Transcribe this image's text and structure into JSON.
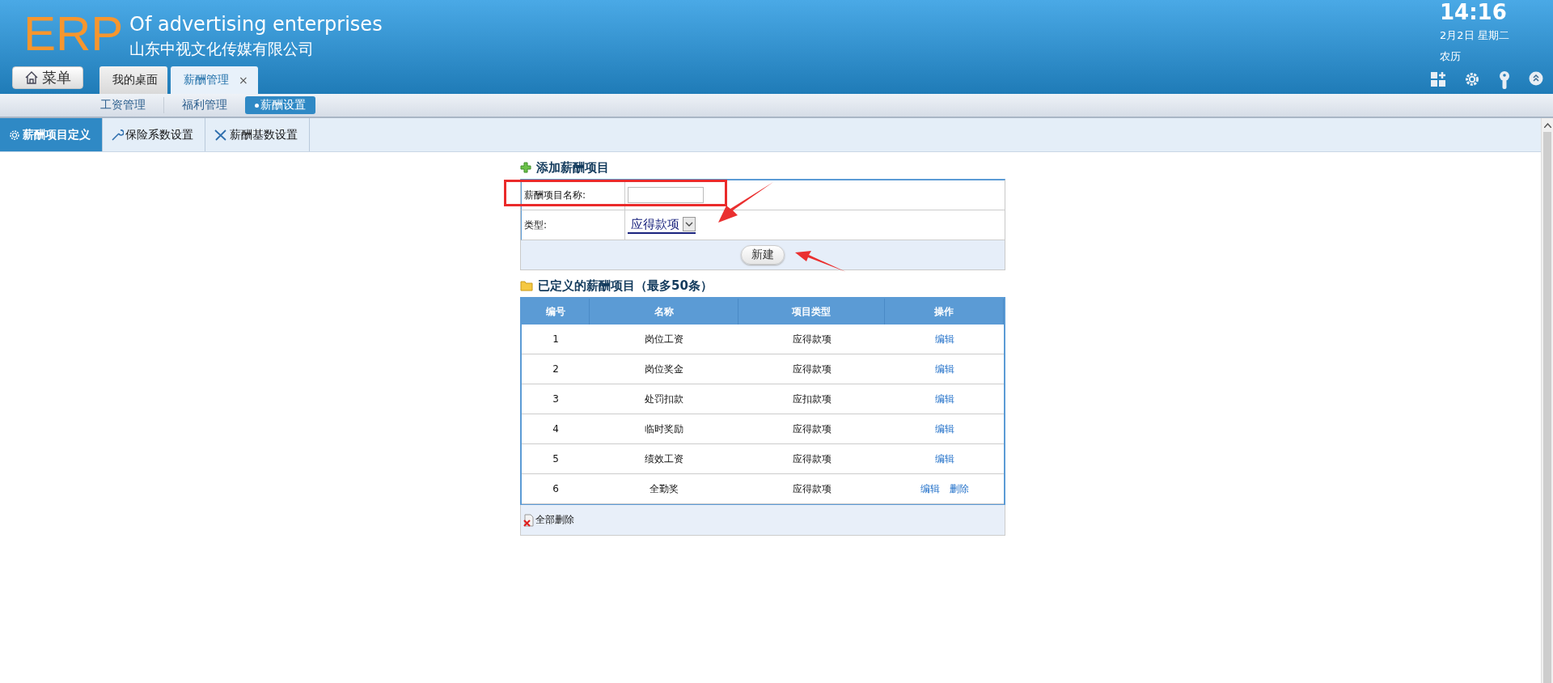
{
  "header": {
    "logo": "ERP",
    "slogan": "Of advertising enterprises",
    "company": "山东中视文化传媒有限公司",
    "menu_button": "菜单",
    "clock": {
      "time": "14:16",
      "date": "2月2日 星期二",
      "lunar": "农历"
    }
  },
  "window_tabs": [
    {
      "label": "我的桌面",
      "selected": false
    },
    {
      "label": "薪酬管理",
      "selected": true,
      "close": "×"
    }
  ],
  "sub_nav": [
    {
      "label": "工资管理",
      "selected": false
    },
    {
      "label": "福利管理",
      "selected": false
    },
    {
      "label": "薪酬设置",
      "selected": true
    }
  ],
  "page_tabs": [
    {
      "label": "薪酬项目定义",
      "kind": "gear",
      "selected": true
    },
    {
      "label": "保险系数设置",
      "kind": "wrench",
      "selected": false
    },
    {
      "label": "薪酬基数设置",
      "kind": "tools",
      "selected": false
    }
  ],
  "add_form": {
    "title": "添加薪酬项目",
    "name_label": "薪酬项目名称:",
    "type_label": "类型:",
    "type_value": "应得款项",
    "submit": "新建"
  },
  "items_table": {
    "title": "已定义的薪酬项目（最多50条）",
    "columns": [
      "编号",
      "名称",
      "项目类型",
      "操作"
    ],
    "rows": [
      {
        "no": "1",
        "name": "岗位工资",
        "type": "应得款项",
        "actions": [
          "编辑"
        ]
      },
      {
        "no": "2",
        "name": "岗位奖金",
        "type": "应得款项",
        "actions": [
          "编辑"
        ]
      },
      {
        "no": "3",
        "name": "处罚扣款",
        "type": "应扣款项",
        "actions": [
          "编辑"
        ]
      },
      {
        "no": "4",
        "name": "临时奖励",
        "type": "应得款项",
        "actions": [
          "编辑"
        ]
      },
      {
        "no": "5",
        "name": "绩效工资",
        "type": "应得款项",
        "actions": [
          "编辑"
        ]
      },
      {
        "no": "6",
        "name": "全勤奖",
        "type": "应得款项",
        "actions": [
          "编辑",
          "删除"
        ]
      }
    ],
    "delete_all": "全部删除"
  }
}
